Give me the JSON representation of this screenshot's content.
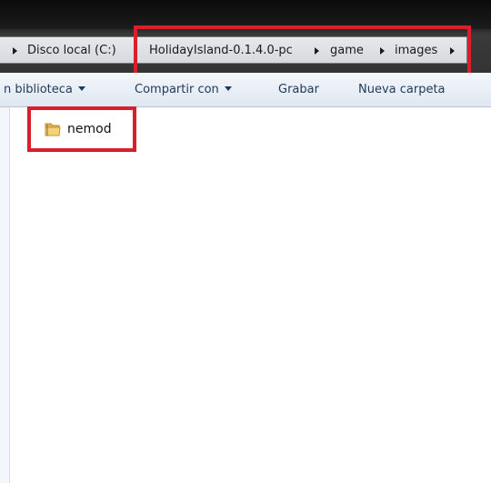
{
  "window": {
    "theme_color_chrome": "#111111",
    "highlight_color": "#d8202b"
  },
  "breadcrumb": {
    "items": [
      {
        "label": "Disco local (C:)"
      },
      {
        "label": "HolidayIsland-0.1.4.0-pc"
      },
      {
        "label": "game"
      },
      {
        "label": "images"
      }
    ],
    "arrow_icon": "chevron-right-icon"
  },
  "toolbar": {
    "include_library_label": "n biblioteca",
    "share_label": "Compartir con",
    "burn_label": "Grabar",
    "new_folder_label": "Nueva carpeta",
    "dropdown_icon": "caret-down-icon"
  },
  "files": {
    "items": [
      {
        "name": "nemod",
        "icon": "folder-icon"
      }
    ]
  }
}
